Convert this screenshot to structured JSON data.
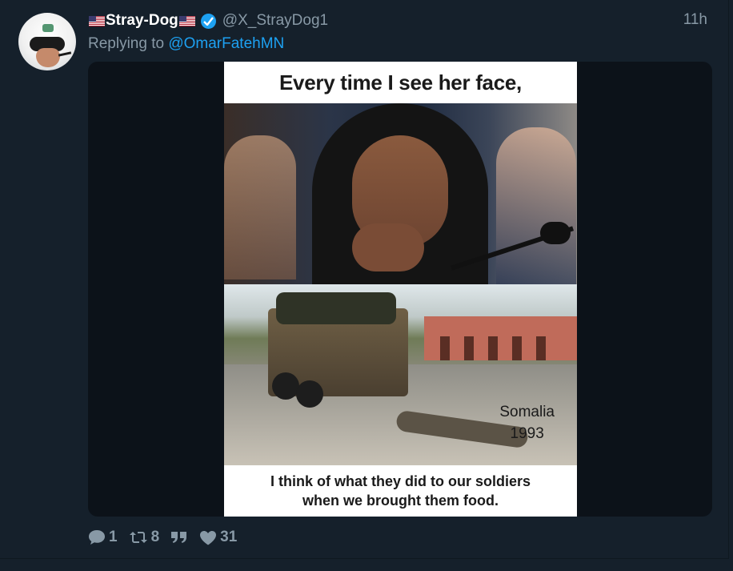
{
  "tweet": {
    "display_name": "Stray-Dog",
    "handle": "@X_StrayDog1",
    "time": "11h",
    "reply_prefix": "Replying to",
    "reply_to": "@OmarFatehMN",
    "media": {
      "caption_top": "Every time I see her face,",
      "photo_label_line1": "Somalia",
      "photo_label_line2": "1993",
      "caption_bottom_line1": "I think of what they did to our soldiers",
      "caption_bottom_line2": "when we brought them food."
    },
    "actions": {
      "replies": "1",
      "retweets": "8",
      "likes": "31"
    }
  },
  "colors": {
    "background": "#15202b",
    "muted": "#8899a6",
    "link": "#1da1f2",
    "verified": "#1da1f2"
  },
  "icons": [
    "flag-us-icon",
    "verified-badge-icon",
    "reply-icon",
    "retweet-icon",
    "quote-icon",
    "heart-icon"
  ]
}
